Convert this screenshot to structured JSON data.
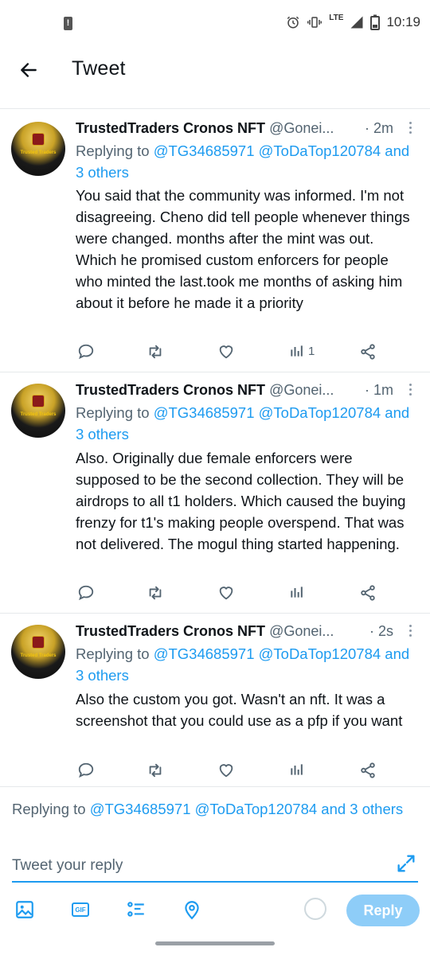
{
  "status_bar": {
    "time": "10:19",
    "network": "LTE"
  },
  "header": {
    "title": "Tweet"
  },
  "tweets": [
    {
      "name": "TrustedTraders Cronos NFT",
      "handle": "@Gonei...",
      "time": "· 2m",
      "replying_prefix": "Replying to ",
      "replying_links": "@TG34685971 @ToDaTop120784",
      "replying_others": "and 3 others",
      "body": "You said that the community was informed. I'm not disagreeing. Cheno did tell people whenever things were changed. months after the mint was out. Which he promised custom enforcers for people who minted the last.took me months of asking him about it before he made it a priority",
      "views": "1"
    },
    {
      "name": "TrustedTraders Cronos NFT",
      "handle": "@Gonei...",
      "time": "· 1m",
      "replying_prefix": "Replying to ",
      "replying_links": "@TG34685971 @ToDaTop120784",
      "replying_others": "and 3 others",
      "body": "Also. Originally due female enforcers were supposed to be the second collection. They will be airdrops to all t1 holders. Which caused the buying frenzy for t1's making people overspend. That was not delivered. The mogul thing started happening.",
      "views": ""
    },
    {
      "name": "TrustedTraders Cronos NFT",
      "handle": "@Gonei...",
      "time": "· 2s",
      "replying_prefix": "Replying to ",
      "replying_links": "@TG34685971 @ToDaTop120784",
      "replying_others": "and 3 others",
      "body": "Also the custom you got. Wasn't an nft. It was a screenshot that you could use as a pfp if you want",
      "views": ""
    }
  ],
  "avatar": {
    "label": "Trusted Traders"
  },
  "reply_composer": {
    "replying_prefix": "Replying to ",
    "replying_links": "@TG34685971 @ToDaTop120784 and 3 others",
    "placeholder": "Tweet your reply",
    "reply_button": "Reply"
  },
  "colors": {
    "accent": "#1d9bf0",
    "reply_button_disabled": "#8ecdf8",
    "secondary_text": "#536471"
  }
}
